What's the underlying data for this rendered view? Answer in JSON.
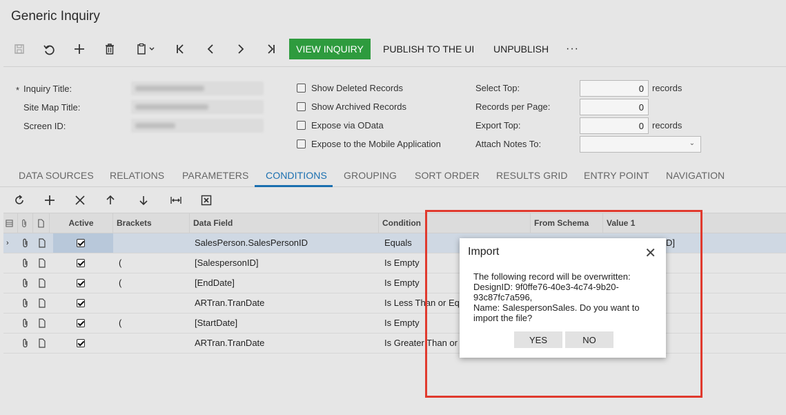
{
  "page_title": "Generic Inquiry",
  "toolbar": {
    "view_inquiry": "VIEW INQUIRY",
    "publish": "PUBLISH TO THE UI",
    "unpublish": "UNPUBLISH",
    "more": "···"
  },
  "form": {
    "inquiry_title_label": "Inquiry Title:",
    "site_map_title_label": "Site Map Title:",
    "screen_id_label": "Screen ID:",
    "required_marker": "*",
    "show_deleted": "Show Deleted Records",
    "show_archived": "Show Archived Records",
    "expose_odata": "Expose via OData",
    "expose_mobile": "Expose to the Mobile Application",
    "select_top_label": "Select Top:",
    "select_top_value": "0",
    "records_per_page_label": "Records per Page:",
    "records_per_page_value": "0",
    "export_top_label": "Export Top:",
    "export_top_value": "0",
    "attach_notes_label": "Attach Notes To:",
    "records_suffix": "records"
  },
  "tabs": [
    {
      "label": "DATA SOURCES",
      "active": false
    },
    {
      "label": "RELATIONS",
      "active": false
    },
    {
      "label": "PARAMETERS",
      "active": false
    },
    {
      "label": "CONDITIONS",
      "active": true
    },
    {
      "label": "GROUPING",
      "active": false
    },
    {
      "label": "SORT ORDER",
      "active": false
    },
    {
      "label": "RESULTS GRID",
      "active": false
    },
    {
      "label": "ENTRY POINT",
      "active": false
    },
    {
      "label": "NAVIGATION",
      "active": false
    }
  ],
  "grid": {
    "columns": {
      "active": "Active",
      "brackets": "Brackets",
      "data_field": "Data Field",
      "condition": "Condition",
      "from_schema": "From Schema",
      "value1": "Value 1"
    },
    "rows": [
      {
        "brackets": "",
        "data_field": "SalesPerson.SalesPersonID",
        "condition": "Equals",
        "value1_tail": "D]"
      },
      {
        "brackets": "(",
        "data_field": "[SalespersonID]",
        "condition": "Is Empty",
        "value1_tail": ""
      },
      {
        "brackets": "(",
        "data_field": "[EndDate]",
        "condition": "Is Empty",
        "value1_tail": ""
      },
      {
        "brackets": "",
        "data_field": "ARTran.TranDate",
        "condition": "Is Less Than or Eq",
        "value1_tail": ""
      },
      {
        "brackets": "(",
        "data_field": "[StartDate]",
        "condition": "Is Empty",
        "value1_tail": ""
      },
      {
        "brackets": "",
        "data_field": "ARTran.TranDate",
        "condition": "Is Greater Than or",
        "value1_tail": ""
      }
    ]
  },
  "dialog": {
    "title": "Import",
    "close": "✕",
    "line1": "The following record will be overwritten:",
    "line2": "DesignID: 9f0ffe76-40e3-4c74-9b20-",
    "line3": "93c87fc7a596,",
    "line4": "Name: SalespersonSales. Do you want to",
    "line5": "import the file?",
    "yes": "YES",
    "no": "NO"
  },
  "colors": {
    "accent": "#1a6fb0",
    "primary_button": "#2e9b3e",
    "highlight_rect": "#e03a2e"
  }
}
